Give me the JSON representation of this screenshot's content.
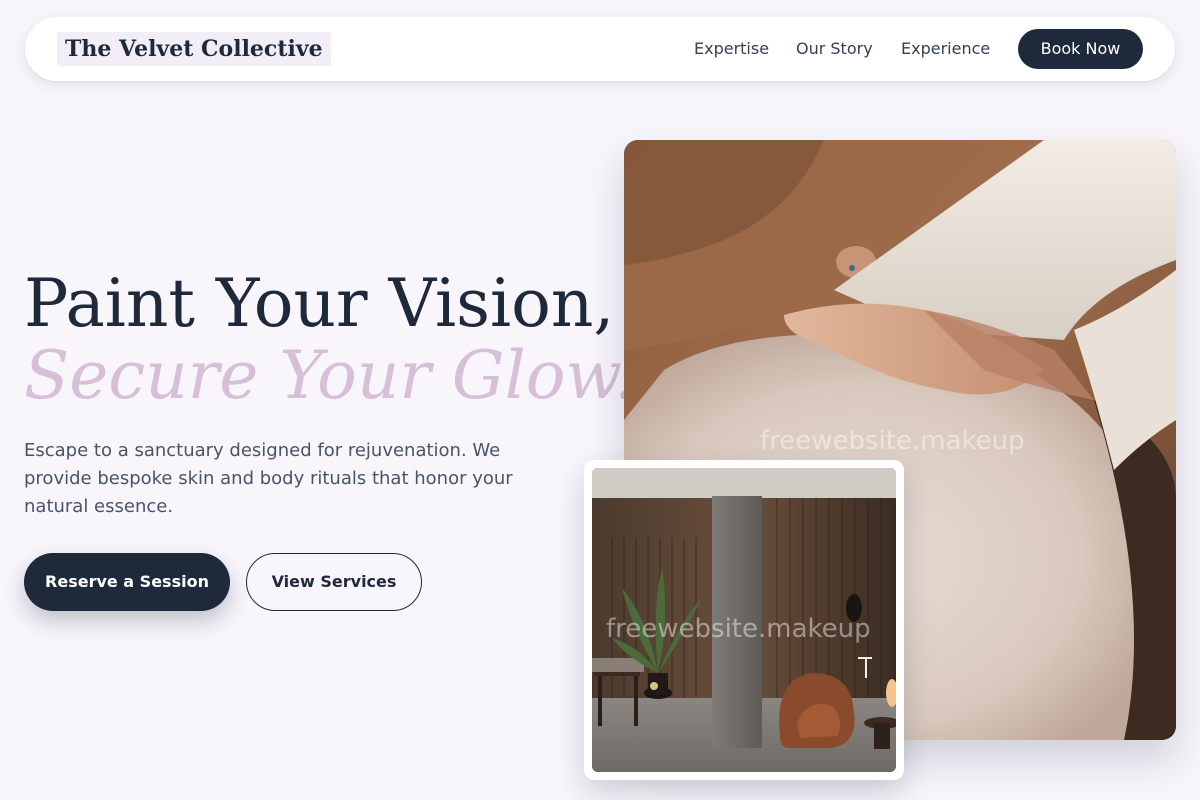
{
  "nav": {
    "logo": "The Velvet Collective",
    "links": [
      "Expertise",
      "Our Story",
      "Experience"
    ],
    "cta": "Book Now"
  },
  "hero": {
    "title_line1": "Paint Your Vision,",
    "title_line2": "Secure Your Glow.",
    "subtitle": "Escape to a sanctuary designed for rejuvenation. We provide bespoke skin and body rituals that honor your natural essence.",
    "primary_button": "Reserve a Session",
    "secondary_button": "View Services"
  },
  "images": {
    "main_watermark": "freewebsite.makeup",
    "secondary_watermark": "freewebsite.makeup"
  },
  "colors": {
    "background": "#f8f5fb",
    "navy": "#1e293b",
    "accent_lavender": "#d6bfd7",
    "body_text": "#475569"
  }
}
